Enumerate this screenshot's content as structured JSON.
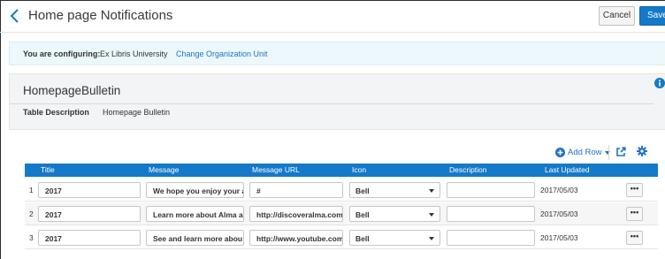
{
  "header": {
    "title": "Home page Notifications",
    "cancel_label": "Cancel",
    "save_label": "Save"
  },
  "config": {
    "label": "You are configuring:",
    "institution": "Ex Libris University",
    "change_link": "Change Organization Unit"
  },
  "details": {
    "table_name": "HomepageBulletin",
    "description_label": "Table Description",
    "description_value": "Homepage Bulletin"
  },
  "toolbar": {
    "add_row_label": "Add Row"
  },
  "table": {
    "columns": [
      "Title",
      "Message",
      "Message URL",
      "Icon",
      "Description",
      "Last Updated"
    ],
    "rows": [
      {
        "num": "1",
        "title": "2017",
        "message": "We hope you enjoy your a",
        "url": "#",
        "icon": "Bell",
        "description": "",
        "last_updated": "2017/05/03",
        "more": "•••"
      },
      {
        "num": "2",
        "title": "2017",
        "message": "Learn more about Alma a",
        "url": "http://discoveralma.com",
        "icon": "Bell",
        "description": "",
        "last_updated": "2017/05/03",
        "more": "•••"
      },
      {
        "num": "3",
        "title": "2017",
        "message": "See and learn more abou",
        "url": "http://www.youtube.com/",
        "icon": "Bell",
        "description": "",
        "last_updated": "2017/05/03",
        "more": "•••"
      }
    ]
  },
  "colors": {
    "accent": "#1479c9",
    "config_bg": "#ecf8fb",
    "panel_bg": "#f2f4f5"
  },
  "icons": [
    "chevron-left-icon",
    "info-icon",
    "plus-circle-icon",
    "caret-down-icon",
    "export-icon",
    "gear-icon"
  ]
}
